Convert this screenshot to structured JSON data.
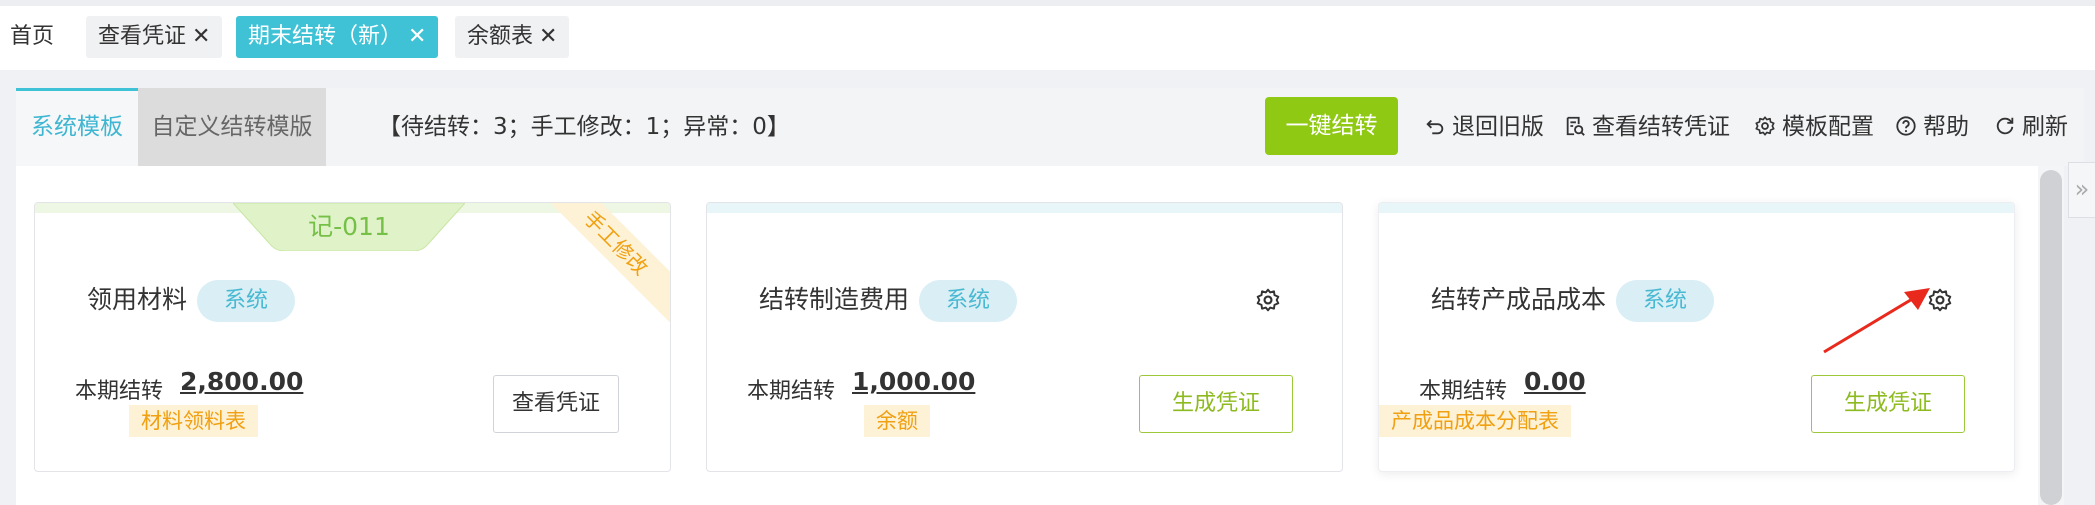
{
  "tabs": [
    {
      "label": "首页",
      "closable": false,
      "active": false
    },
    {
      "label": "查看凭证",
      "closable": true,
      "active": false
    },
    {
      "label": "期末结转（新）",
      "closable": true,
      "active": true
    },
    {
      "label": "余额表",
      "closable": true,
      "active": false
    }
  ],
  "tab_close_glyph": "✕",
  "toolbar": {
    "template_tabs": [
      "系统模板",
      "自定义结转模版"
    ],
    "summary": "【待结转：3；手工修改：1；异常：0】",
    "one_click_label": "一键结转",
    "actions": [
      {
        "label": "退回旧版",
        "icon": "undo-icon"
      },
      {
        "label": "查看结转凭证",
        "icon": "voucher-search-icon"
      },
      {
        "label": "模板配置",
        "icon": "gear-icon"
      },
      {
        "label": "帮助",
        "icon": "help-circle-icon"
      },
      {
        "label": "刷新",
        "icon": "refresh-icon"
      }
    ]
  },
  "cards": [
    {
      "title": "领用材料",
      "badge": "系统",
      "voucher_no": "记-011",
      "ribbon": "手工修改",
      "period_label": "本期结转",
      "amount": "2,800.00",
      "source": "材料领料表",
      "button": "查看凭证"
    },
    {
      "title": "结转制造费用",
      "badge": "系统",
      "period_label": "本期结转",
      "amount": "1,000.00",
      "source": "余额",
      "button": "生成凭证"
    },
    {
      "title": "结转产成品成本",
      "badge": "系统",
      "period_label": "本期结转",
      "amount": "0.00",
      "source": "产成品成本分配表",
      "button": "生成凭证"
    }
  ],
  "collapse_glyph": "»",
  "colors": {
    "accent": "#3fc1d6",
    "primary_green": "#8fc914",
    "warning_orange": "#f0a010",
    "annotation_red": "#e8291c"
  }
}
